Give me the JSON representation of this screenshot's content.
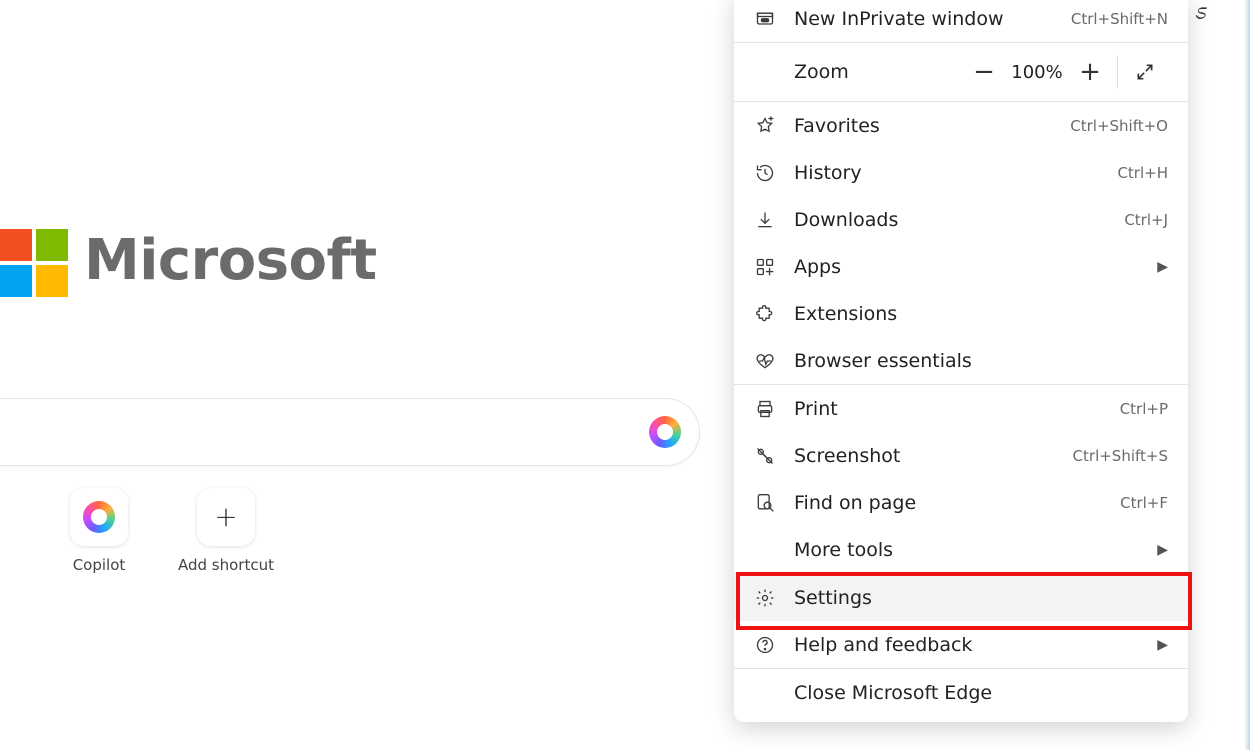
{
  "brand": {
    "name": "Microsoft"
  },
  "tiles": {
    "copilot": "Copilot",
    "add_shortcut": "Add shortcut"
  },
  "menu": {
    "new_inprivate": {
      "label": "New InPrivate window",
      "accel": "Ctrl+Shift+N"
    },
    "zoom": {
      "label": "Zoom",
      "value": "100%"
    },
    "favorites": {
      "label": "Favorites",
      "accel": "Ctrl+Shift+O"
    },
    "history": {
      "label": "History",
      "accel": "Ctrl+H"
    },
    "downloads": {
      "label": "Downloads",
      "accel": "Ctrl+J"
    },
    "apps": {
      "label": "Apps"
    },
    "extensions": {
      "label": "Extensions"
    },
    "essentials": {
      "label": "Browser essentials"
    },
    "print": {
      "label": "Print",
      "accel": "Ctrl+P"
    },
    "screenshot": {
      "label": "Screenshot",
      "accel": "Ctrl+Shift+S"
    },
    "find": {
      "label": "Find on page",
      "accel": "Ctrl+F"
    },
    "more_tools": {
      "label": "More tools"
    },
    "settings": {
      "label": "Settings"
    },
    "help": {
      "label": "Help and feedback"
    },
    "close_edge": {
      "label": "Close Microsoft Edge"
    }
  }
}
